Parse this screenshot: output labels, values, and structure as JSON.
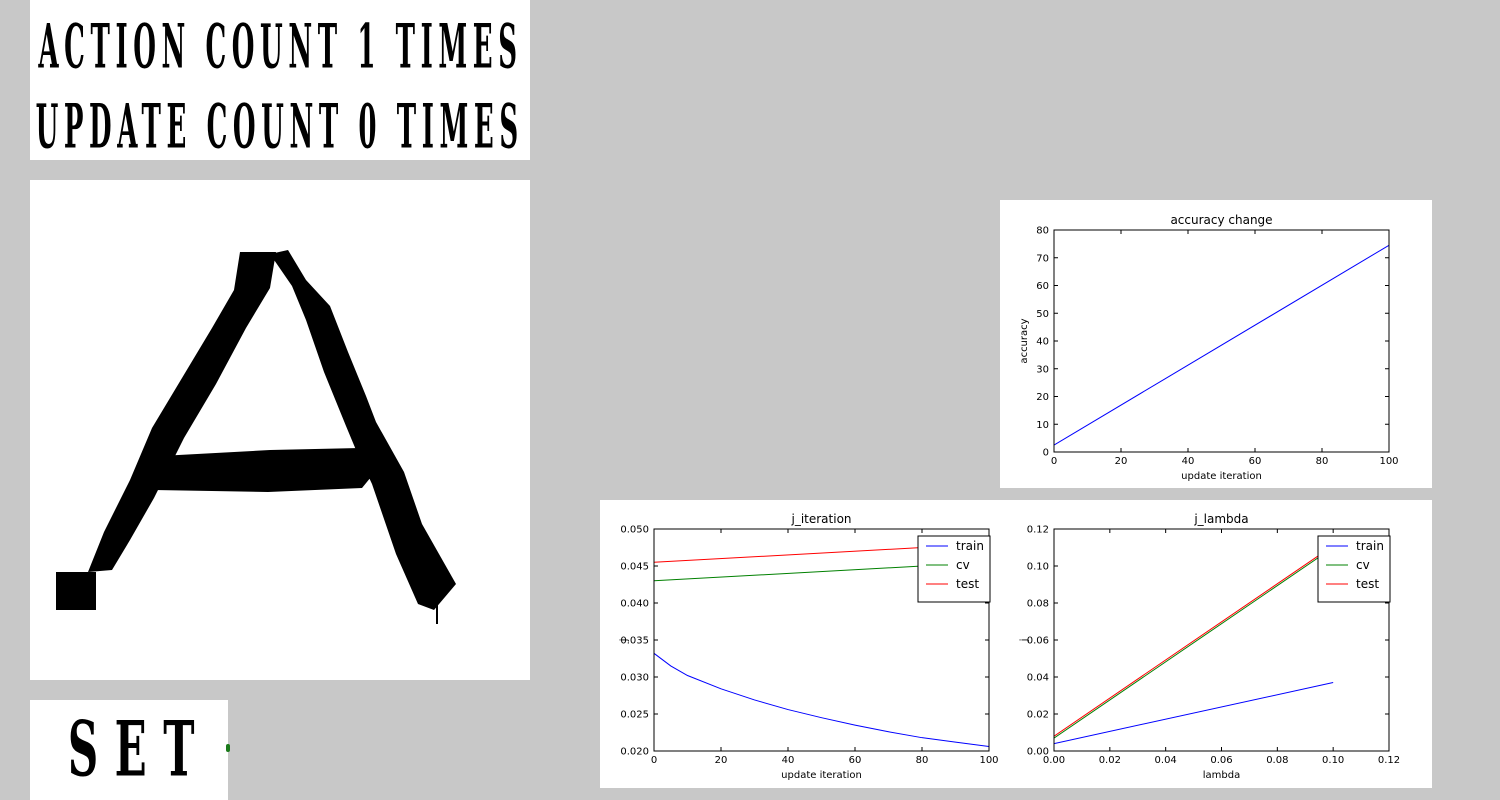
{
  "counters": {
    "action_text": "ACTION COUNT 1 TIMES",
    "update_text": "UPDATE COUNT 0 TIMES"
  },
  "canvas": {
    "drawn_letter": "A"
  },
  "set_button": {
    "label": "SET"
  },
  "chart_data": [
    {
      "type": "line",
      "title": "accuracy change",
      "xlabel": "update iteration",
      "ylabel": "accuracy",
      "xlim": [
        0,
        100
      ],
      "ylim": [
        0,
        80
      ],
      "xticks": [
        0,
        20,
        40,
        60,
        80,
        100
      ],
      "yticks": [
        0,
        10,
        20,
        30,
        40,
        50,
        60,
        70,
        80
      ],
      "tick_decimals": [
        0,
        0
      ],
      "legend": false,
      "series": [
        {
          "color": "#0000ff",
          "x": [
            0,
            100
          ],
          "y": [
            2.5,
            74.5
          ]
        }
      ]
    },
    {
      "type": "line",
      "title": "j_iteration",
      "xlabel": "update iteration",
      "ylabel": "j",
      "xlim": [
        0,
        100
      ],
      "ylim": [
        0.02,
        0.05
      ],
      "xticks": [
        0,
        20,
        40,
        60,
        80,
        100
      ],
      "yticks": [
        0.02,
        0.025,
        0.03,
        0.035,
        0.04,
        0.045,
        0.05
      ],
      "tick_decimals": [
        0,
        3
      ],
      "legend": true,
      "legend_position": "top-right",
      "series": [
        {
          "name": "train",
          "color": "#0000ff",
          "x": [
            0,
            5,
            10,
            20,
            30,
            40,
            50,
            60,
            70,
            80,
            90,
            100
          ],
          "y": [
            0.0332,
            0.0315,
            0.0302,
            0.0284,
            0.0269,
            0.0256,
            0.0245,
            0.0235,
            0.0226,
            0.0218,
            0.0212,
            0.0206
          ]
        },
        {
          "name": "cv",
          "color": "#008000",
          "x": [
            0,
            100
          ],
          "y": [
            0.043,
            0.0455
          ]
        },
        {
          "name": "test",
          "color": "#ff0000",
          "x": [
            0,
            100
          ],
          "y": [
            0.0455,
            0.048
          ]
        }
      ]
    },
    {
      "type": "line",
      "title": "j_lambda",
      "xlabel": "lambda",
      "ylabel": "j",
      "xlim": [
        0,
        0.12
      ],
      "ylim": [
        0,
        0.12
      ],
      "xticks": [
        0.0,
        0.02,
        0.04,
        0.06,
        0.08,
        0.1,
        0.12
      ],
      "yticks": [
        0.0,
        0.02,
        0.04,
        0.06,
        0.08,
        0.1,
        0.12
      ],
      "tick_decimals": [
        2,
        2
      ],
      "legend": true,
      "legend_position": "top-right",
      "series": [
        {
          "name": "train",
          "color": "#0000ff",
          "x": [
            0,
            0.1
          ],
          "y": [
            0.004,
            0.037
          ]
        },
        {
          "name": "cv",
          "color": "#008000",
          "x": [
            0,
            0.1
          ],
          "y": [
            0.007,
            0.11
          ]
        },
        {
          "name": "test",
          "color": "#ff0000",
          "x": [
            0,
            0.1
          ],
          "y": [
            0.008,
            0.111
          ]
        }
      ]
    }
  ]
}
